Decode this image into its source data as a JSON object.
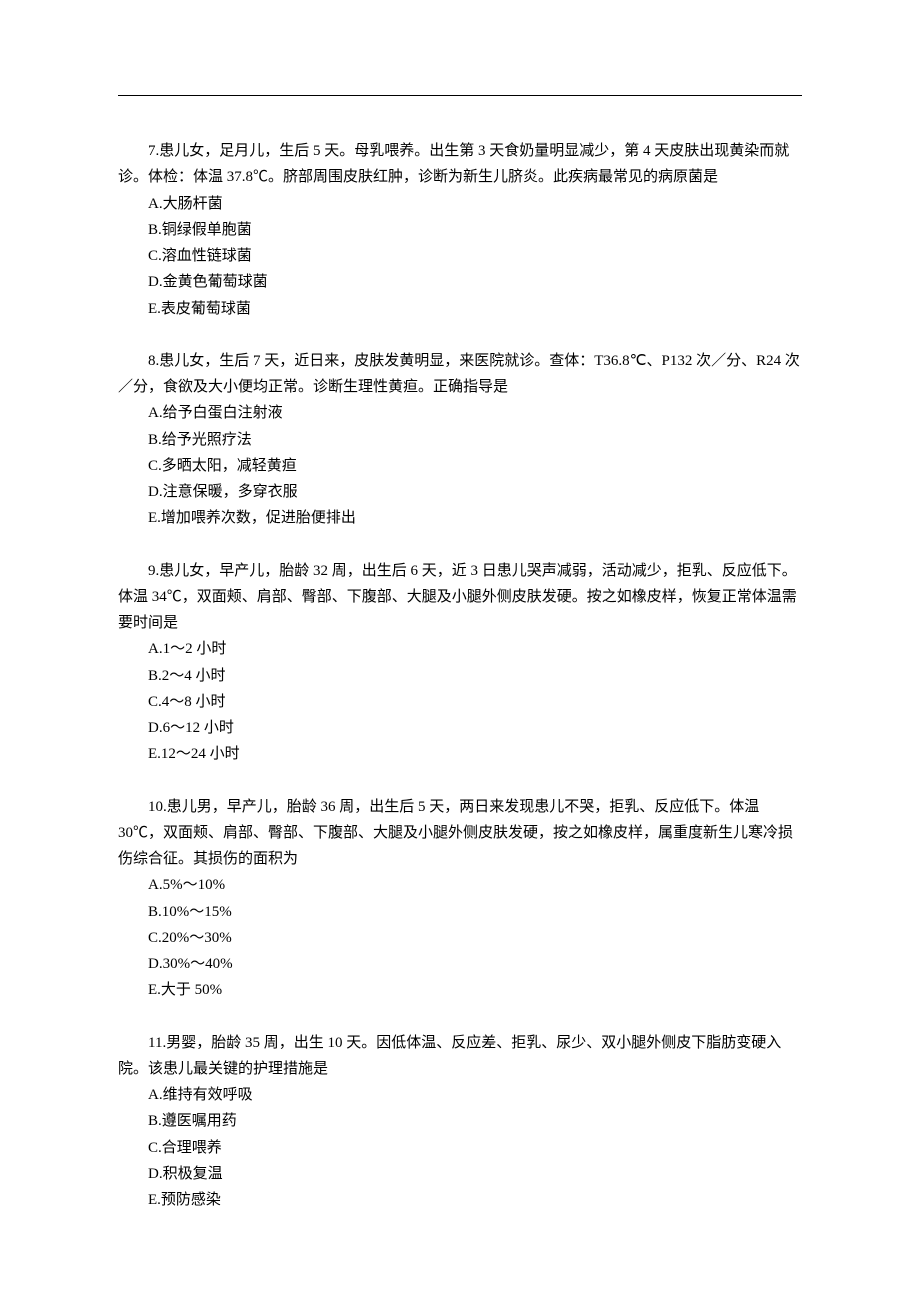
{
  "questions": [
    {
      "number": "7.",
      "stem": "患儿女，足月儿，生后 5 天。母乳喂养。出生第 3 天食奶量明显减少，第 4 天皮肤出现黄染而就诊。体检：体温 37.8℃。脐部周围皮肤红肿，诊断为新生儿脐炎。此疾病最常见的病原菌是",
      "options": [
        "A.大肠杆菌",
        "B.铜绿假单胞菌",
        "C.溶血性链球菌",
        "D.金黄色葡萄球菌",
        "E.表皮葡萄球菌"
      ]
    },
    {
      "number": "8.",
      "stem": "患儿女，生后 7 天，近日来，皮肤发黄明显，来医院就诊。查体：T36.8℃、P132 次／分、R24 次／分，食欲及大小便均正常。诊断生理性黄疸。正确指导是",
      "options": [
        "A.给予白蛋白注射液",
        "B.给予光照疗法",
        "C.多晒太阳，减轻黄疸",
        "D.注意保暖，多穿衣服",
        "E.增加喂养次数，促进胎便排出"
      ]
    },
    {
      "number": "9.",
      "stem": "患儿女，早产儿，胎龄 32 周，出生后 6 天，近 3 日患儿哭声减弱，活动减少，拒乳、反应低下。体温 34℃，双面颊、肩部、臀部、下腹部、大腿及小腿外侧皮肤发硬。按之如橡皮样，恢复正常体温需要时间是",
      "options": [
        "A.1～2 小时",
        "B.2～4 小时",
        "C.4～8 小时",
        "D.6～12 小时",
        "E.12～24 小时"
      ]
    },
    {
      "number": "10.",
      "stem": "患儿男，早产儿，胎龄 36 周，出生后 5 天，两日来发现患儿不哭，拒乳、反应低下。体温 30℃，双面颊、肩部、臀部、下腹部、大腿及小腿外侧皮肤发硬，按之如橡皮样，属重度新生儿寒冷损伤综合征。其损伤的面积为",
      "options": [
        "A.5%～10%",
        "B.10%～15%",
        "C.20%～30%",
        "D.30%～40%",
        "E.大于 50%"
      ]
    },
    {
      "number": "11.",
      "stem": "男婴，胎龄 35 周，出生 10 天。因低体温、反应差、拒乳、尿少、双小腿外侧皮下脂肪变硬入院。该患儿最关键的护理措施是",
      "options": [
        "A.维持有效呼吸",
        "B.遵医嘱用药",
        "C.合理喂养",
        "D.积极复温",
        "E.预防感染"
      ]
    }
  ]
}
